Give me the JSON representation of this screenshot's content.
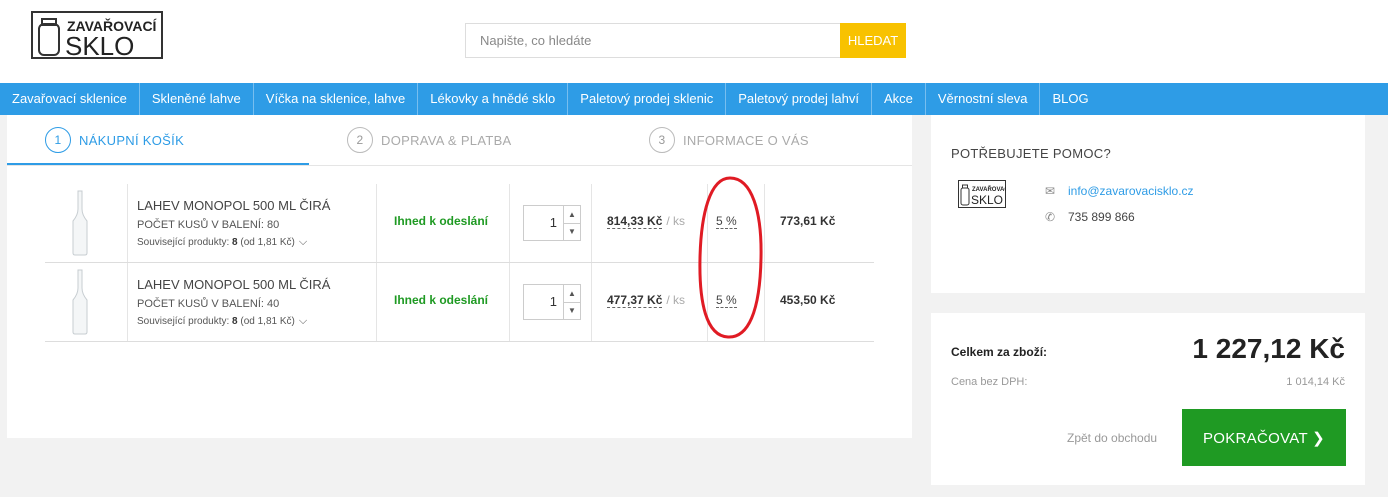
{
  "logo": {
    "top": "ZAVAŘOVACÍ",
    "bottom": "SKLO"
  },
  "search": {
    "placeholder": "Napište, co hledáte",
    "button": "HLEDAT"
  },
  "nav": [
    "Zavařovací sklenice",
    "Skleněné lahve",
    "Víčka na sklenice, lahve",
    "Lékovky a hnědé sklo",
    "Paletový prodej sklenic",
    "Paletový prodej lahví",
    "Akce",
    "Věrnostní sleva",
    "BLOG"
  ],
  "steps": [
    {
      "num": "1",
      "label": "NÁKUPNÍ KOŠÍK"
    },
    {
      "num": "2",
      "label": "DOPRAVA & PLATBA"
    },
    {
      "num": "3",
      "label": "INFORMACE O VÁS"
    }
  ],
  "items": [
    {
      "name": "LAHEV MONOPOL 500 ML ČIRÁ",
      "pack_label": "POČET KUSŮ V BALENÍ:",
      "pack_value": "80",
      "related_label": "Související produkty:",
      "related_count": "8",
      "related_from": "(od 1,81 Kč)",
      "stock": "Ihned k odeslání",
      "qty": "1",
      "unit_price": "814,33 Kč",
      "unit": "/ ks",
      "discount": "5 %",
      "total": "773,61 Kč"
    },
    {
      "name": "LAHEV MONOPOL 500 ML ČIRÁ",
      "pack_label": "POČET KUSŮ V BALENÍ:",
      "pack_value": "40",
      "related_label": "Související produkty:",
      "related_count": "8",
      "related_from": "(od 1,81 Kč)",
      "stock": "Ihned k odeslání",
      "qty": "1",
      "unit_price": "477,37 Kč",
      "unit": "/ ks",
      "discount": "5 %",
      "total": "453,50 Kč"
    }
  ],
  "help": {
    "title": "POTŘEBUJETE POMOC?",
    "email": "info@zavarovacisklo.cz",
    "phone": "735 899 866"
  },
  "summary": {
    "goods_label": "Celkem za zboží:",
    "goods_value": "1 227,12 Kč",
    "no_vat_label": "Cena bez DPH:",
    "no_vat_value": "1 014,14 Kč",
    "back": "Zpět do obchodu",
    "continue": "POKRAČOVAT"
  },
  "colors": {
    "nav": "#2e9ce6",
    "search_button": "#f8c200",
    "continue_button": "#1f9a23",
    "stock": "#1f9a23",
    "annotation": "#e01b24"
  }
}
